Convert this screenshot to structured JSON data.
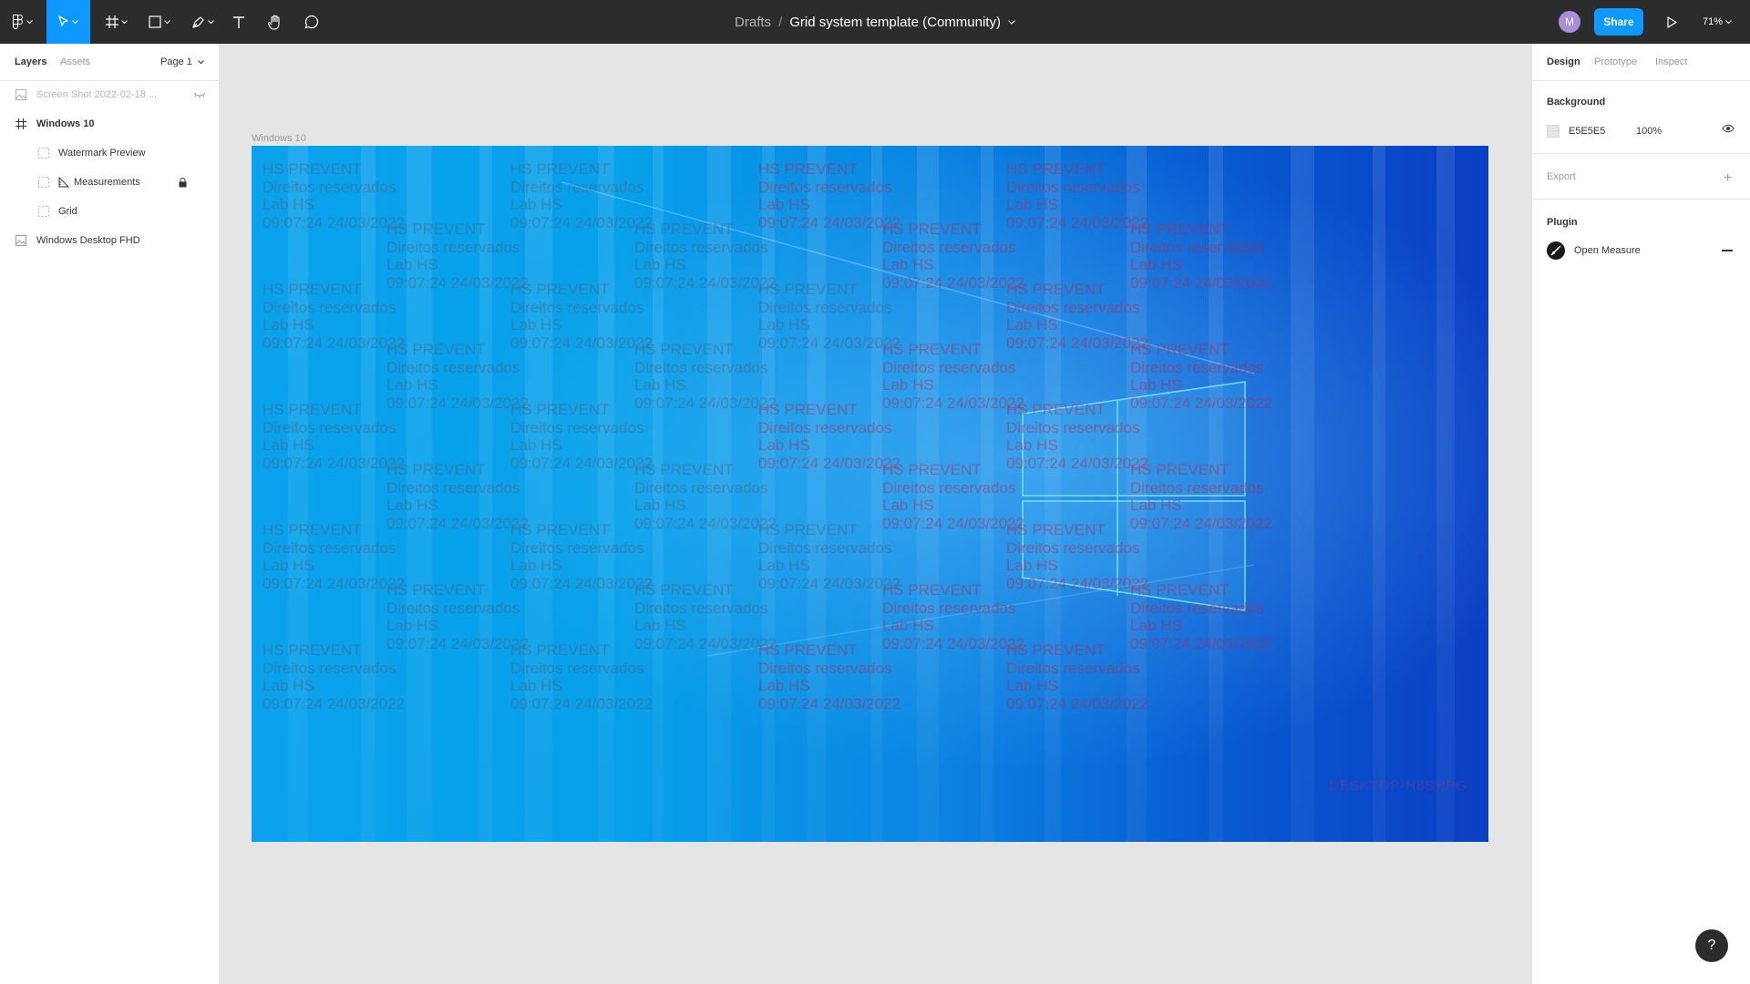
{
  "toolbar": {
    "breadcrumb": "Drafts",
    "separator": "/",
    "file_name": "Grid system template (Community)",
    "avatar_initial": "M",
    "share_label": "Share",
    "zoom": "71%"
  },
  "left_panel": {
    "tabs": [
      "Layers",
      "Assets"
    ],
    "page": "Page 1",
    "layers": [
      {
        "name": "Screen Shot 2022-02-18 ...",
        "icon": "image-icon"
      },
      {
        "name": "Windows 10",
        "icon": "frame-icon"
      },
      {
        "name": "Watermark Preview",
        "icon": "grid-layer-icon"
      },
      {
        "name": "Measurements",
        "icon": "ruler-icon"
      },
      {
        "name": "Grid",
        "icon": "grid-layer-icon"
      },
      {
        "name": "Windows Desktop FHD",
        "icon": "image-icon"
      }
    ]
  },
  "right_panel": {
    "tabs": [
      "Design",
      "Prototype",
      "Inspect"
    ],
    "background_title": "Background",
    "background_hex": "E5E5E5",
    "background_opacity": "100%",
    "export_title": "Export",
    "plugin_title": "Plugin",
    "plugin_name": "Open Measure"
  },
  "canvas": {
    "frame_label": "Windows 10",
    "watermark_lines": [
      "HS PREVENT",
      "Direitos reservados",
      "Lab HS",
      "09:07:24 24/03/2022"
    ],
    "desktop_text": "DESKTOP-H8SHPG"
  },
  "colors": {
    "toolbar_bg": "#2c2c2c",
    "accent": "#0d99ff",
    "canvas_bg": "#e5e5e5"
  },
  "help_label": "?"
}
